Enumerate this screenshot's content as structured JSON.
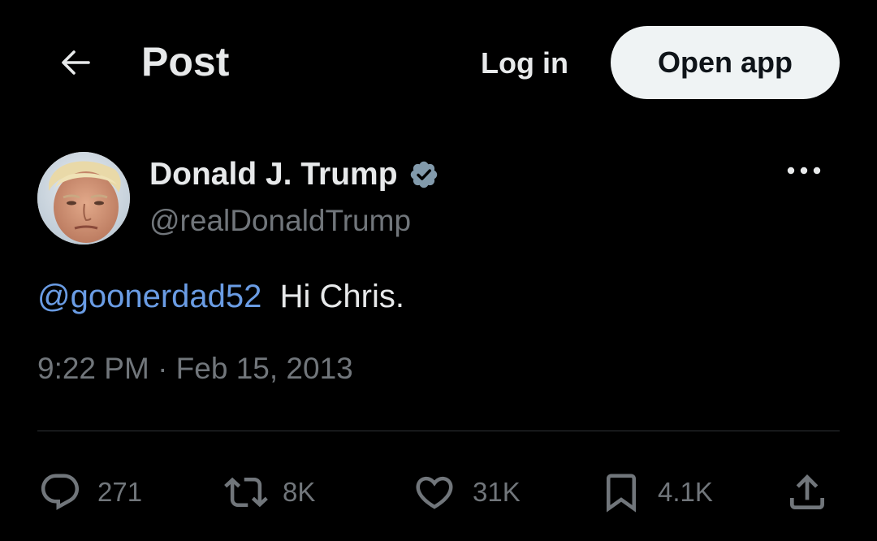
{
  "header": {
    "title": "Post",
    "login_label": "Log in",
    "open_app_label": "Open app"
  },
  "author": {
    "display_name": "Donald J. Trump",
    "handle": "@realDonaldTrump",
    "verified": true
  },
  "tweet": {
    "mention": "@goonerdad52",
    "text": "Hi Chris.",
    "timestamp": "9:22 PM · Feb 15, 2013"
  },
  "actions": {
    "replies": "271",
    "reposts": "8K",
    "likes": "31K",
    "bookmarks": "4.1K"
  },
  "icons": {
    "back": "arrow-left-icon",
    "verified": "verified-badge-icon",
    "more": "more-dots-icon",
    "reply": "reply-bubble-icon",
    "repost": "repost-icon",
    "like": "heart-icon",
    "bookmark": "bookmark-icon",
    "share": "share-icon"
  },
  "colors": {
    "background": "#000000",
    "text_primary": "#e7e9ea",
    "text_secondary": "#71767b",
    "mention": "#6a9ce4",
    "button_bg": "#eff3f4",
    "verified_badge": "#829aab"
  }
}
